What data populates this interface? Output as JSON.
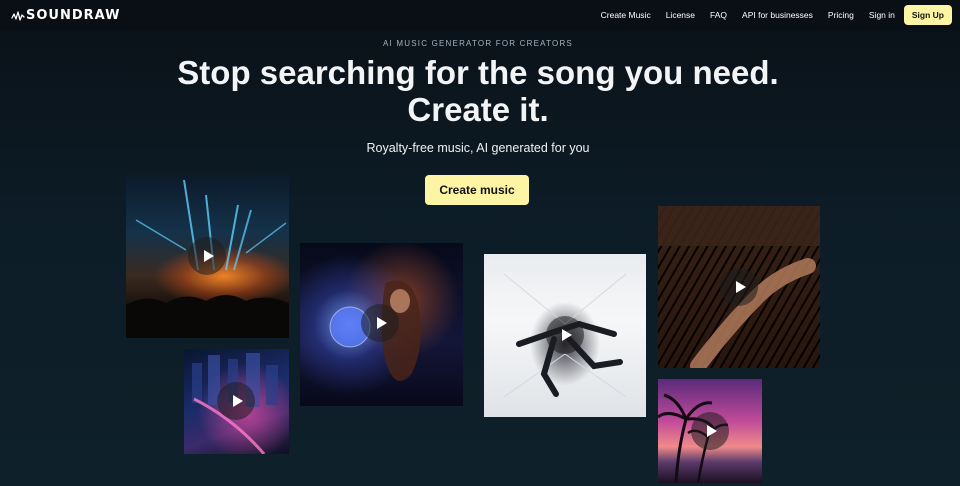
{
  "brand": {
    "name": "SOUNDRAW"
  },
  "nav": {
    "links": [
      "Create Music",
      "License",
      "FAQ",
      "API for businesses",
      "Pricing",
      "Sign in"
    ],
    "signup_label": "Sign Up"
  },
  "hero": {
    "eyebrow": "AI MUSIC GENERATOR FOR CREATORS",
    "headline_line1": "Stop searching for the song you need.",
    "headline_line2": "Create it.",
    "subhead": "Royalty-free music, AI generated for you",
    "cta_label": "Create music"
  },
  "colors": {
    "background": "#0b1620",
    "nav_background": "#0a0f15",
    "accent": "#fdf5a4",
    "eyebrow": "#9fb4c3"
  },
  "media_tiles": [
    {
      "name": "concert-video",
      "icon": "play-icon"
    },
    {
      "name": "city-video",
      "icon": "play-icon"
    },
    {
      "name": "disco-ball-video",
      "icon": "play-icon"
    },
    {
      "name": "dancer-video",
      "icon": "play-icon"
    },
    {
      "name": "piano-video",
      "icon": "play-icon"
    },
    {
      "name": "palm-sunset-video",
      "icon": "play-icon"
    }
  ]
}
